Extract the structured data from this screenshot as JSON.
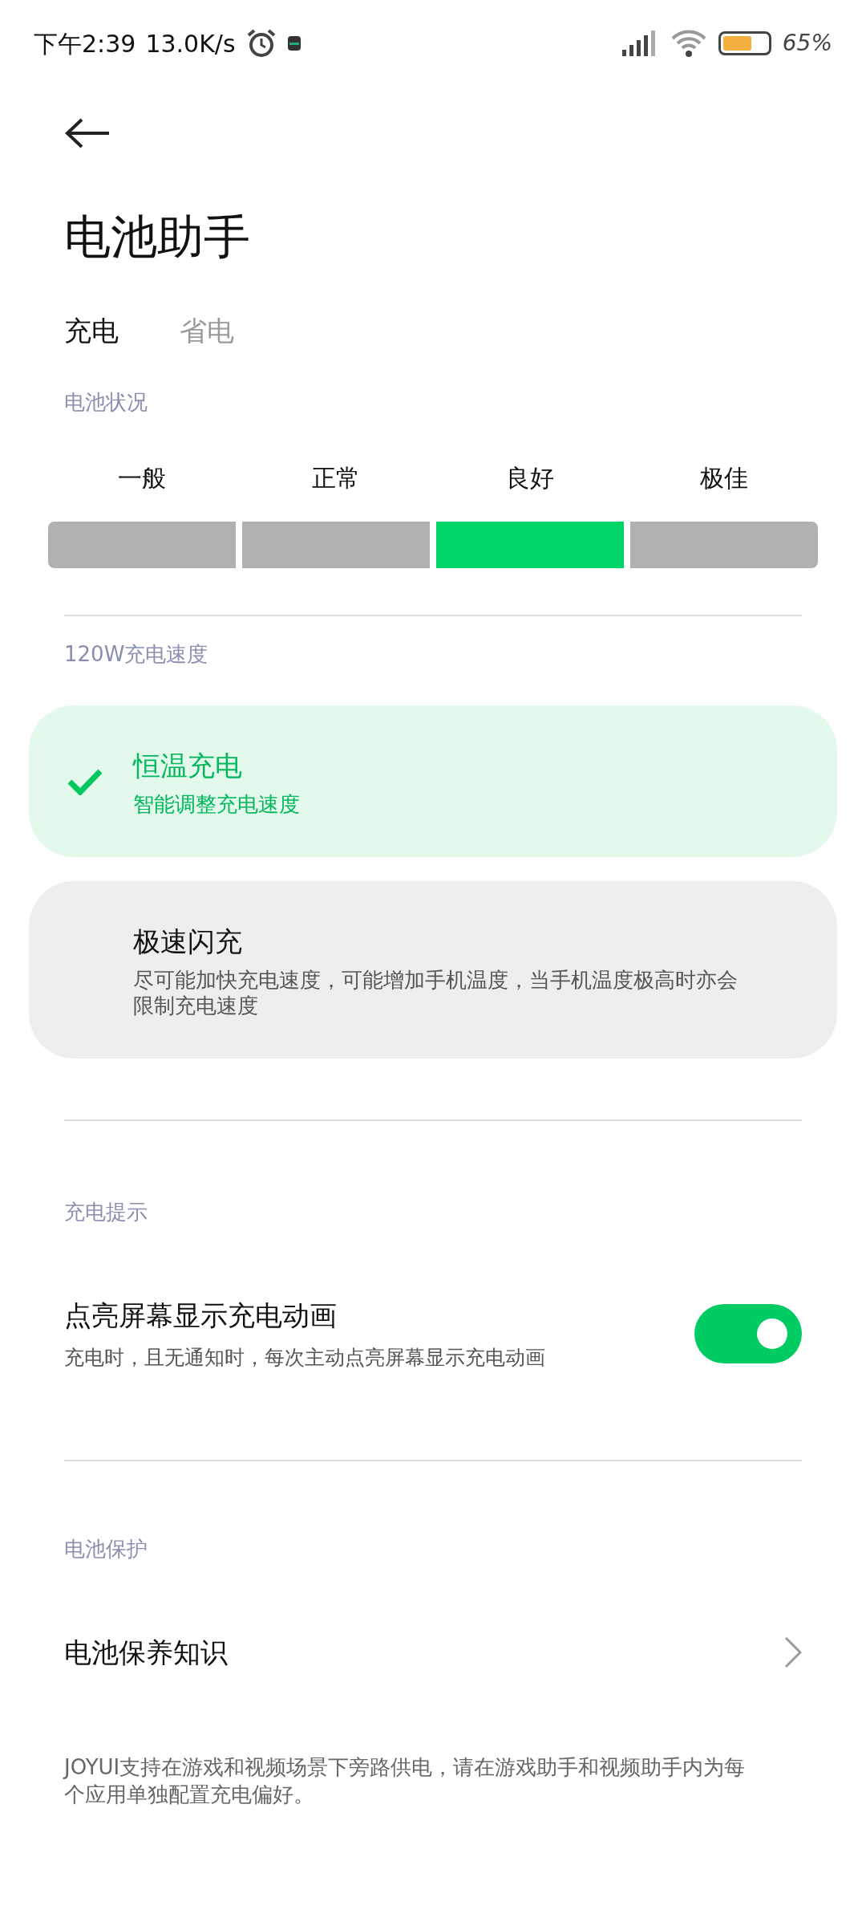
{
  "status_bar": {
    "time": "下午2:39",
    "speed": "13.0K/s",
    "battery_percent": "65%"
  },
  "title": "电池助手",
  "tabs": [
    {
      "label": "充电",
      "selected": true
    },
    {
      "label": "省电",
      "selected": false
    }
  ],
  "battery_status": {
    "label": "电池状况",
    "grades": [
      {
        "label": "一般",
        "selected": false
      },
      {
        "label": "正常",
        "selected": false
      },
      {
        "label": "良好",
        "selected": true
      },
      {
        "label": "极佳",
        "selected": false
      }
    ]
  },
  "charging_speed": {
    "label": "120W充电速度",
    "modes": [
      {
        "title": "恒温充电",
        "description": "智能调整充电速度",
        "selected": true
      },
      {
        "title": "极速闪充",
        "description": "尽可能加快充电速度，可能增加手机温度，当手机温度极高时亦会限制充电速度",
        "selected": false
      }
    ]
  },
  "charging_tips": {
    "label": "充电提示",
    "setting": {
      "title": "点亮屏幕显示充电动画",
      "description": "充电时，且无通知时，每次主动点亮屏幕显示充电动画",
      "on": true
    }
  },
  "battery_protection": {
    "label": "电池保护",
    "link": "电池保养知识"
  },
  "footer": "JOYUI支持在游戏和视频场景下旁路供电，请在游戏助手和视频助手内为每个应用单独配置充电偏好。"
}
